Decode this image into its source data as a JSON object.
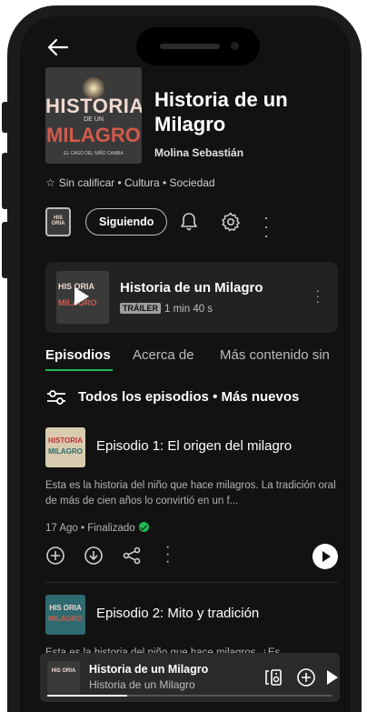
{
  "show": {
    "cover_line1": "HISTORIA",
    "cover_line2": "DE UN",
    "cover_line3": "MILAGRO",
    "cover_line4": "EL CASO DEL NIÑO CAMBA",
    "title": "Historia de un Milagro",
    "author": "Molina Sebastián",
    "rating": "Sin calificar",
    "categories": "Cultura • Sociedad",
    "meta_sep": " • "
  },
  "actions": {
    "thumb_text": "HIS ORIA",
    "follow_label": "Siguiendo"
  },
  "trailer": {
    "thumb_a": "HIS ORIA",
    "thumb_b": "MILAGRO",
    "title": "Historia de un Milagro",
    "badge": "TRÁILER",
    "duration": "1 min 40 s"
  },
  "tabs": [
    {
      "label": "Episodios"
    },
    {
      "label": "Acerca de"
    },
    {
      "label": "Más contenido sin"
    }
  ],
  "filter": {
    "label": "Todos los episodios • Más nuevos"
  },
  "episodes": [
    {
      "art_top": "HISTORIA",
      "art_bottom": "MILAGRO",
      "title": "Episodio 1: El origen del milagro",
      "description": "Esta es la historia del niño que hace milagros. La tradición oral de más de cien años lo convirtió en un f...",
      "date": "17 Ago • Finalizado"
    },
    {
      "art_top": "HIS ORIA",
      "art_bottom": "MILAGRO",
      "title": "Episodio 2: Mito y tradición",
      "description": "Esta es la historia del niño que hace milagros. ¿Es"
    }
  ],
  "player": {
    "art_text": "HIS ORIA",
    "title": "Historia de un Milagro",
    "subtitle": "Historia de un Milagro",
    "progress": 0.28
  },
  "colors": {
    "accent": "#1db954",
    "background": "#121212"
  }
}
